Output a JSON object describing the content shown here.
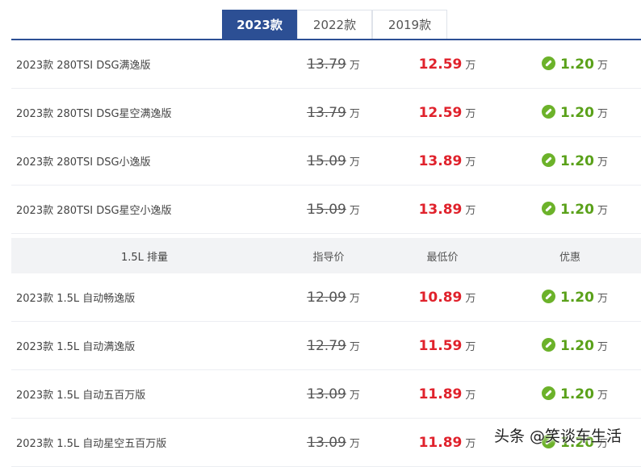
{
  "tabs": [
    "2023款",
    "2022款",
    "2019款"
  ],
  "group1": [
    {
      "name": "2023款 280TSI DSG满逸版",
      "guide": "13.79",
      "low": "12.59",
      "disc": "1.20"
    },
    {
      "name": "2023款 280TSI DSG星空满逸版",
      "guide": "13.79",
      "low": "12.59",
      "disc": "1.20"
    },
    {
      "name": "2023款 280TSI DSG小逸版",
      "guide": "15.09",
      "low": "13.89",
      "disc": "1.20"
    },
    {
      "name": "2023款 280TSI DSG星空小逸版",
      "guide": "15.09",
      "low": "13.89",
      "disc": "1.20"
    }
  ],
  "header": {
    "name": "1.5L 排量",
    "guide": "指导价",
    "low": "最低价",
    "disc": "优惠"
  },
  "group2": [
    {
      "name": "2023款 1.5L 自动畅逸版",
      "guide": "12.09",
      "low": "10.89",
      "disc": "1.20"
    },
    {
      "name": "2023款 1.5L 自动满逸版",
      "guide": "12.79",
      "low": "11.59",
      "disc": "1.20"
    },
    {
      "name": "2023款 1.5L 自动五百万版",
      "guide": "13.09",
      "low": "11.89",
      "disc": "1.20"
    },
    {
      "name": "2023款 1.5L 自动星空五百万版",
      "guide": "13.09",
      "low": "11.89",
      "disc": "1.20"
    }
  ],
  "unit": "万",
  "watermark": "头条 @笑谈车生活"
}
